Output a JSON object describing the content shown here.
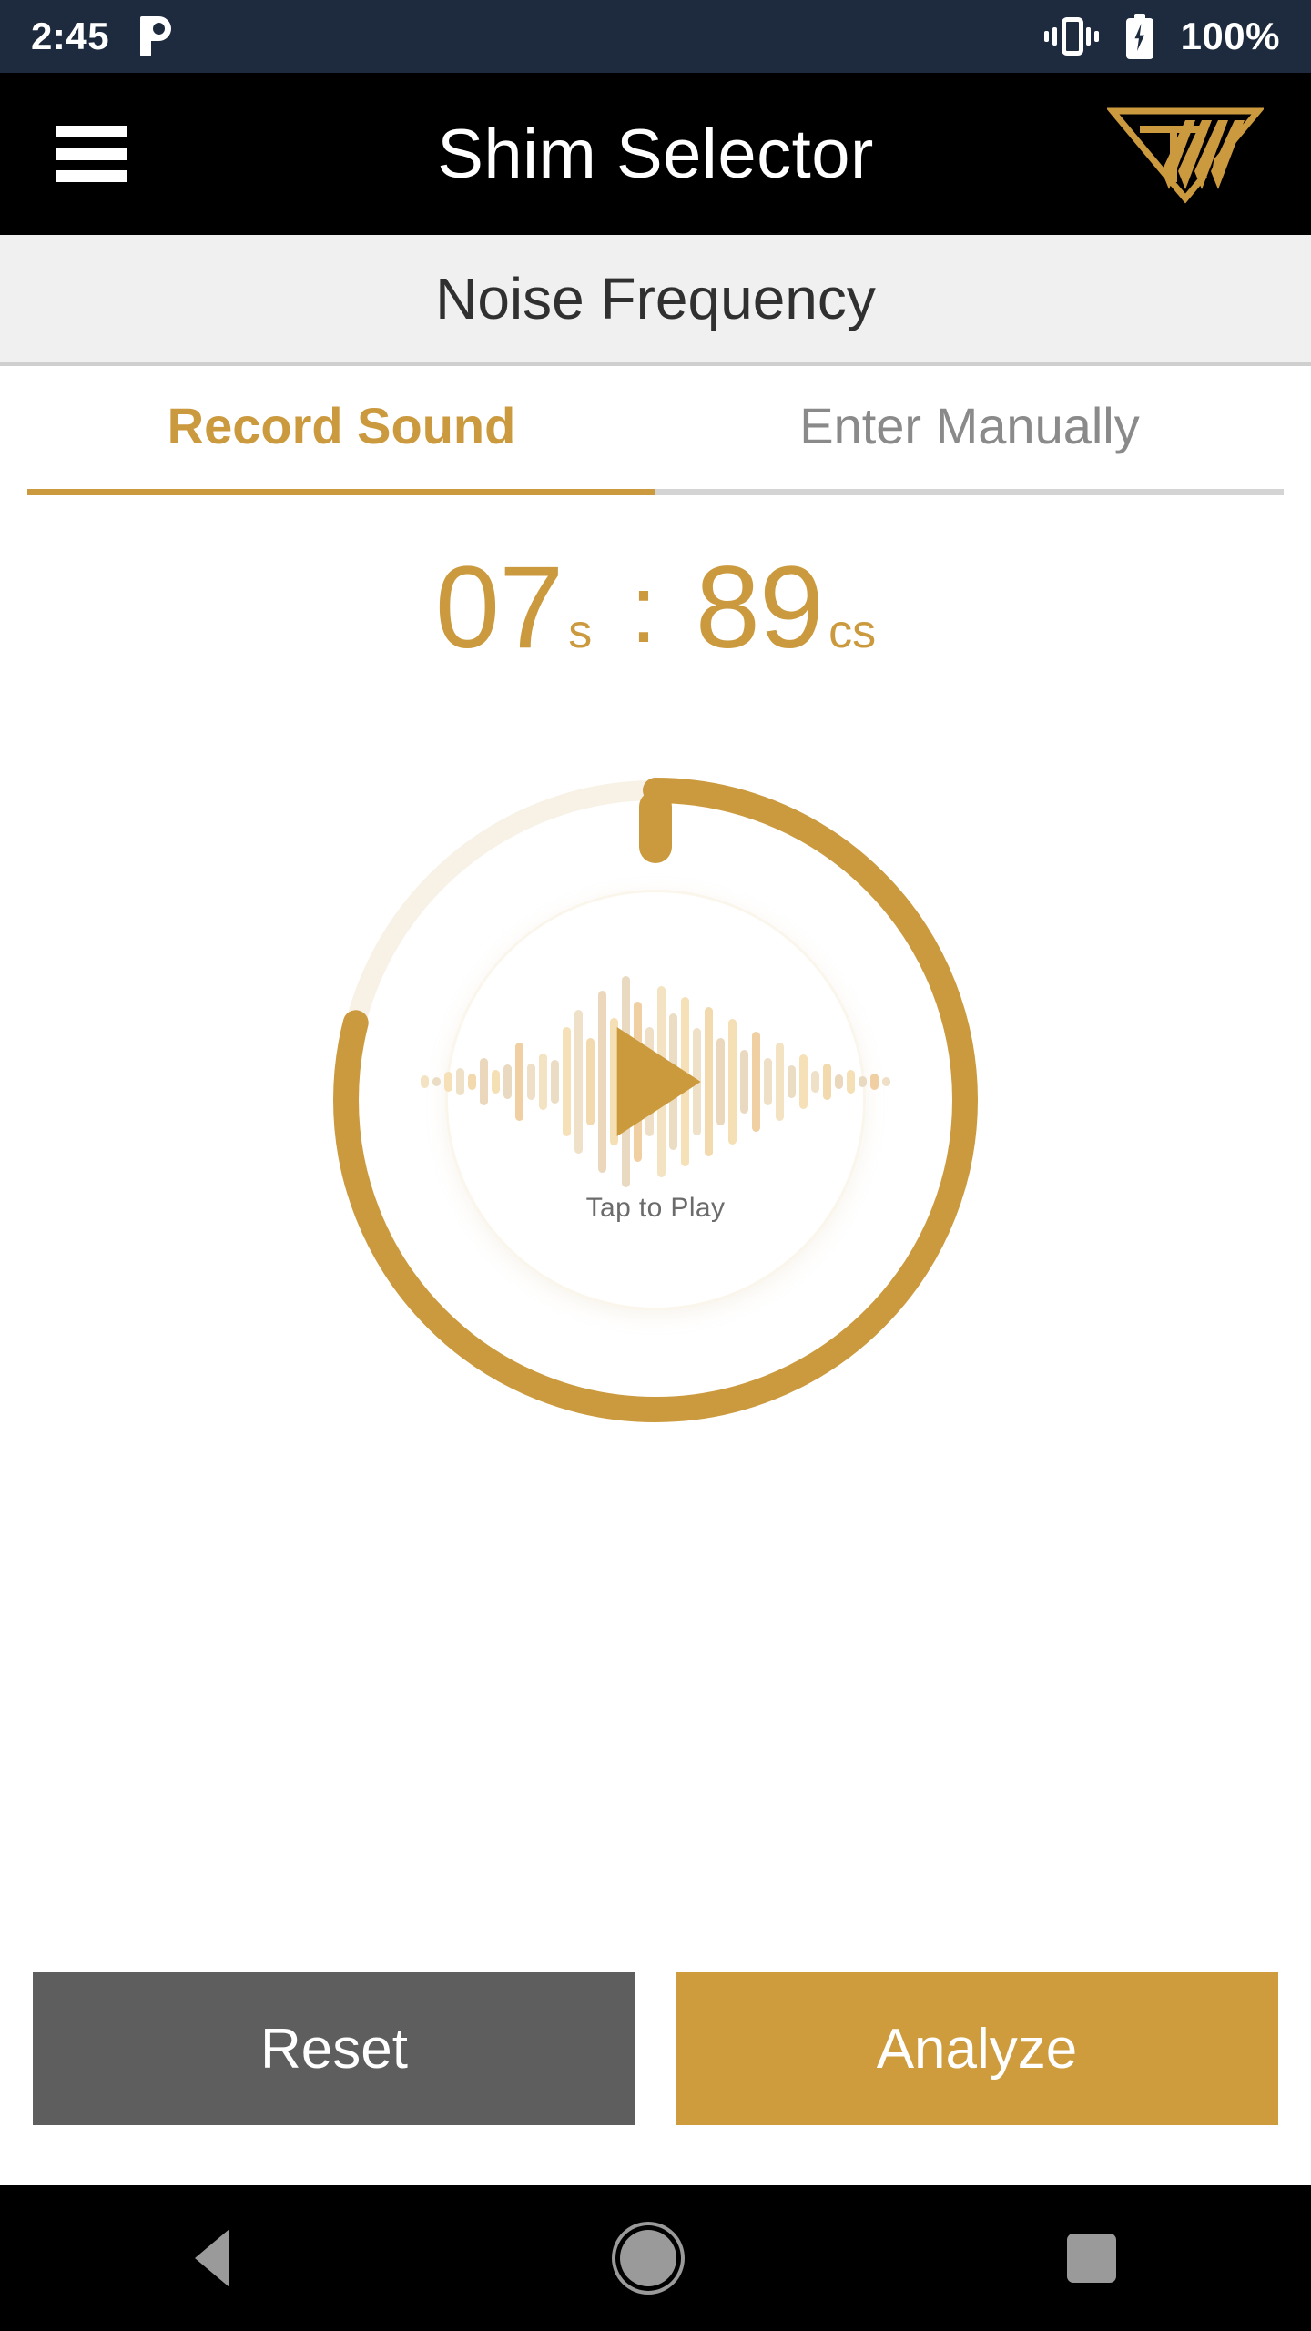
{
  "status_bar": {
    "time": "2:45",
    "battery_percent": "100%",
    "icons": [
      "pandora-notification-icon",
      "vibrate-icon",
      "battery-charging-icon"
    ],
    "background_color": "#1E2B3E"
  },
  "app_bar": {
    "title": "Shim Selector",
    "menu_icon": "hamburger-menu-icon",
    "logo_label": "TW",
    "background_color": "#000000",
    "logo_color": "#CC9A3E"
  },
  "section": {
    "title": "Noise Frequency",
    "background_color": "#F0F0F0"
  },
  "tabs": {
    "items": [
      {
        "label": "Record Sound",
        "active": true
      },
      {
        "label": "Enter Manually",
        "active": false
      }
    ],
    "active_color": "#CC9A3E",
    "inactive_color": "#8A8A8A"
  },
  "timer": {
    "seconds": "07",
    "seconds_unit": "s",
    "separator": ":",
    "centiseconds": "89",
    "centiseconds_unit": "cs",
    "color": "#CC9A3E"
  },
  "dial": {
    "progress_percent": 79,
    "progress_color": "#CC9A3E",
    "track_color": "#F7F1E6",
    "knob_name": "dial-knob",
    "play_button_label": "Tap to Play",
    "play_icon": "play-triangle-icon",
    "waveform_icon": "audio-waveform-icon"
  },
  "actions": {
    "reset_label": "Reset",
    "reset_color": "#5E5E5E",
    "analyze_label": "Analyze",
    "analyze_color": "#CE9B3D"
  },
  "nav_bar": {
    "back_icon": "back-triangle-icon",
    "home_icon": "home-circle-icon",
    "recents_icon": "recents-square-icon",
    "background_color": "#000000"
  }
}
